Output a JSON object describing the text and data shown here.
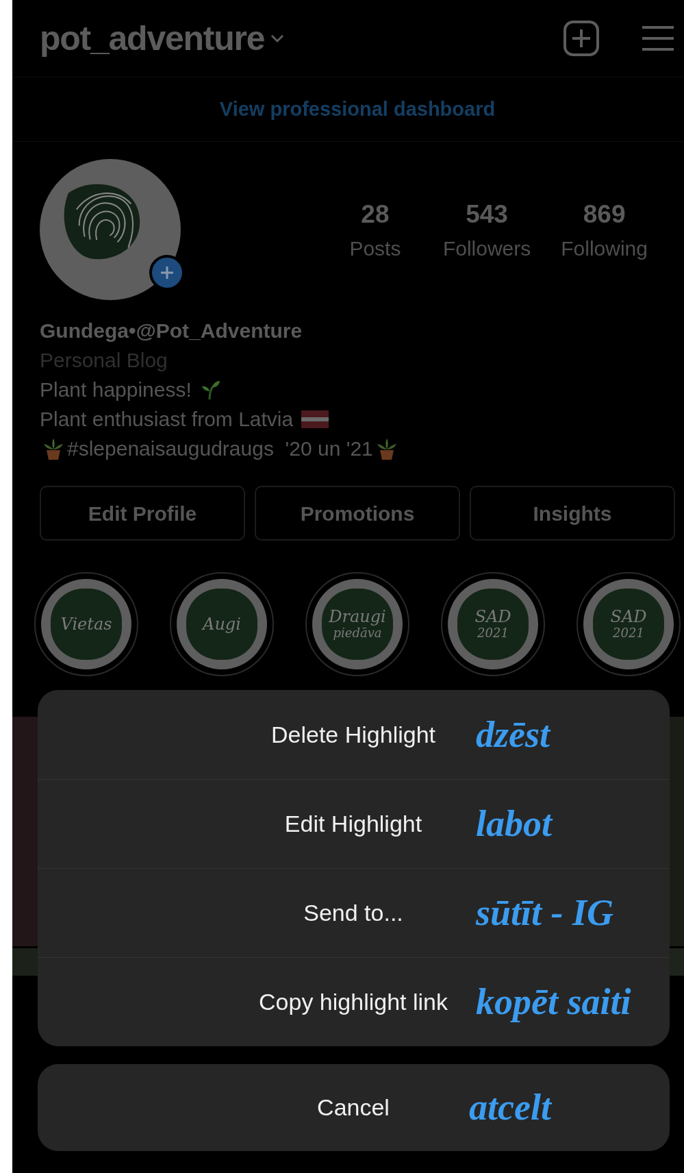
{
  "header": {
    "username": "pot_adventure"
  },
  "dashboard_link": "View professional dashboard",
  "stats": [
    {
      "value": "28",
      "label": "Posts"
    },
    {
      "value": "543",
      "label": "Followers"
    },
    {
      "value": "869",
      "label": "Following"
    }
  ],
  "profile": {
    "name": "Gundega•@Pot_Adventure",
    "category": "Personal Blog",
    "bio": [
      {
        "kind": "seedling",
        "text": "Plant happiness!"
      },
      {
        "kind": "flag",
        "text": "Plant enthusiast from Latvia"
      },
      {
        "kind": "pots",
        "text": "#slepenaisaugudraugs  '20 un '21"
      }
    ]
  },
  "buttons": [
    "Edit Profile",
    "Promotions",
    "Insights"
  ],
  "highlights": [
    {
      "cover_text": [
        "Vietas"
      ]
    },
    {
      "cover_text": [
        "Augi"
      ]
    },
    {
      "cover_text": [
        "Draugi",
        "piedāva"
      ]
    },
    {
      "cover_text": [
        "SAD",
        "2021"
      ]
    },
    {
      "cover_text": [
        "SAD",
        "2021"
      ]
    }
  ],
  "action_sheet": {
    "items": [
      {
        "label": "Delete Highlight",
        "note": "dzēst"
      },
      {
        "label": "Edit Highlight",
        "note": "labot"
      },
      {
        "label": "Send to...",
        "note": "sūtīt - IG"
      },
      {
        "label": "Copy highlight link",
        "note": "kopēt saiti"
      }
    ],
    "cancel": {
      "label": "Cancel",
      "note": "atcelt"
    }
  }
}
